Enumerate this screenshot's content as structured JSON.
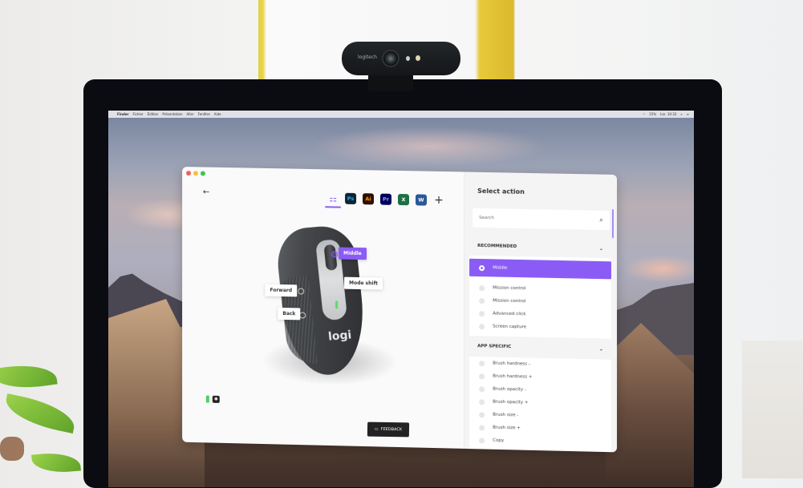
{
  "os_menubar": {
    "apple_icon": "apple-icon",
    "menus": [
      "Finder",
      "Fichier",
      "Édition",
      "Présentation",
      "Aller",
      "Fenêtre",
      "Aide"
    ],
    "status": {
      "wifi_icon": "wifi-icon",
      "battery": "15%",
      "clock": "lun. 10:32",
      "spotlight_icon": "search-icon"
    }
  },
  "webcam": {
    "brand": "logitech"
  },
  "app": {
    "back_label": "←",
    "app_tabs": [
      {
        "id": "all",
        "label": "⚏",
        "icon": "all-apps-icon",
        "selected": true
      },
      {
        "id": "ps",
        "label": "Ps",
        "icon": "photoshop-icon"
      },
      {
        "id": "ai",
        "label": "Ai",
        "icon": "illustrator-icon"
      },
      {
        "id": "pr",
        "label": "Pr",
        "icon": "premiere-icon"
      },
      {
        "id": "excel",
        "label": "X",
        "icon": "excel-icon"
      },
      {
        "id": "word",
        "label": "W",
        "icon": "word-icon"
      },
      {
        "id": "add",
        "label": "+",
        "icon": "plus-icon"
      }
    ],
    "device": {
      "brand_logo": "logi",
      "callouts": {
        "middle": "Middle",
        "mode_shift": "Mode shift",
        "forward": "Forward",
        "back": "Back"
      }
    },
    "feedback_label": "FEEDBACK",
    "accent_color": "#8a5cf5"
  },
  "action_panel": {
    "title": "Select action",
    "search_placeholder": "Search",
    "sections": [
      {
        "title": "RECOMMENDED",
        "items": [
          {
            "label": "Middle",
            "selected": true
          },
          {
            "label": "Mission control"
          },
          {
            "label": "Mission control"
          },
          {
            "label": "Advanced click"
          },
          {
            "label": "Screen capture"
          }
        ]
      },
      {
        "title": "APP SPECIFIC",
        "items": [
          {
            "label": "Brush hardness -"
          },
          {
            "label": "Brush hardness +"
          },
          {
            "label": "Brush opacity -"
          },
          {
            "label": "Brush opacity +"
          },
          {
            "label": "Brush size -"
          },
          {
            "label": "Brush size +"
          },
          {
            "label": "Copy"
          }
        ]
      }
    ]
  }
}
